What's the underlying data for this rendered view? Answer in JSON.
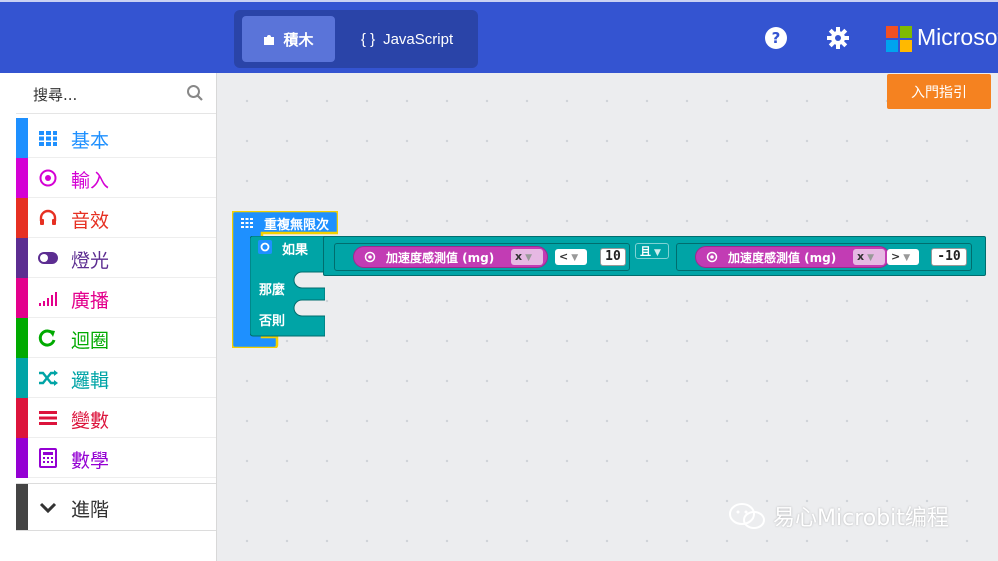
{
  "header": {
    "tabs": [
      {
        "label": "積木",
        "icon": "puzzle-icon",
        "active": true
      },
      {
        "label": "JavaScript",
        "icon": "braces-icon",
        "active": false
      }
    ],
    "brand": "Microsof",
    "icons": [
      "help-icon",
      "gear-icon",
      "microsoft-logo"
    ]
  },
  "sidebar": {
    "search": {
      "placeholder": "搜尋..."
    },
    "categories": [
      {
        "label": "基本",
        "color": "#1e90ff",
        "icon": "grid-icon"
      },
      {
        "label": "輸入",
        "color": "#d400d4",
        "icon": "radio-target-icon"
      },
      {
        "label": "音效",
        "color": "#e63022",
        "icon": "headphones-icon"
      },
      {
        "label": "燈光",
        "color": "#5c2d91",
        "icon": "toggle-icon"
      },
      {
        "label": "廣播",
        "color": "#e3008c",
        "icon": "signal-bars-icon"
      },
      {
        "label": "迴圈",
        "color": "#00aa00",
        "icon": "refresh-icon"
      },
      {
        "label": "邏輯",
        "color": "#00a4a6",
        "icon": "shuffle-icon"
      },
      {
        "label": "變數",
        "color": "#dc143c",
        "icon": "list-lines-icon"
      },
      {
        "label": "數學",
        "color": "#9400d3",
        "icon": "calculator-icon"
      }
    ],
    "advanced": {
      "label": "進階",
      "icon": "chevron-down-icon"
    }
  },
  "workspace": {
    "guide_button": "入門指引",
    "forever_label": "重複無限次",
    "if_label": "如果",
    "then_label": "那麼",
    "else_label": "否則",
    "and_label": "且",
    "left_condition": {
      "sensor": "加速度感測值 (mg)",
      "axis": "x",
      "op": "<",
      "value": "10"
    },
    "right_condition": {
      "sensor": "加速度感測值 (mg)",
      "axis": "x",
      "op": ">",
      "value": "-10"
    }
  },
  "watermark": "易心Microbit编程"
}
